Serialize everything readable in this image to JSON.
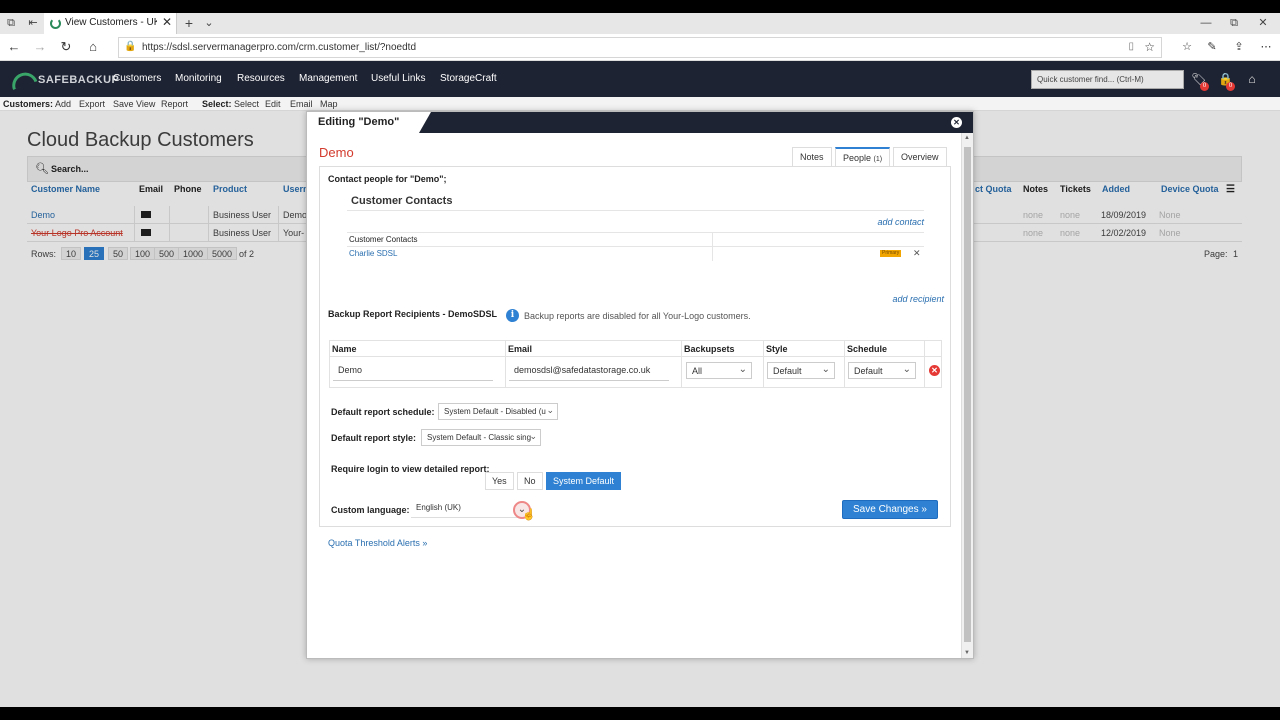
{
  "browser": {
    "tab_title": "View Customers - UK Cl",
    "url": "https://sdsl.servermanagerpro.com/crm.customer_list/?noedtd"
  },
  "appnav": {
    "brand": "SAFEBACKUP",
    "items": [
      "Customers",
      "Monitoring",
      "Resources",
      "Management",
      "Useful Links",
      "StorageCraft"
    ],
    "quick_find_placeholder": "Quick customer find... (Ctrl-M)",
    "badge_tickets": "0",
    "badge_alerts": "0"
  },
  "subbar": {
    "customers_label": "Customers:",
    "customers_actions": [
      "Add",
      "Export",
      "Save View",
      "Report"
    ],
    "select_label": "Select:",
    "select_actions": [
      "Select",
      "Edit",
      "Email",
      "Map"
    ]
  },
  "page": {
    "title": "Cloud Backup Customers",
    "search_label": "Search...",
    "columns_left": [
      "Customer Name",
      "Email",
      "Phone",
      "Product",
      "Usern"
    ],
    "columns_right": [
      "ct Quota",
      "Notes",
      "Tickets",
      "Added",
      "Device Quota"
    ],
    "rows": [
      {
        "name": "Demo",
        "product": "Business User",
        "user": "Demo",
        "notes": "none",
        "tickets": "none",
        "added": "18/09/2019",
        "device_quota": "None"
      },
      {
        "name": "Your Logo Pro Account",
        "product": "Business User",
        "user": "Your-",
        "notes": "none",
        "tickets": "none",
        "added": "12/02/2019",
        "device_quota": "None"
      }
    ],
    "rows_label": "Rows:",
    "row_options": [
      "10",
      "25",
      "50",
      "100",
      "500",
      "1000",
      "5000"
    ],
    "of_pages": "of 2",
    "page_label": "Page:",
    "page_num": "1"
  },
  "modal": {
    "header": "Editing \"Demo\"",
    "customer_name": "Demo",
    "tabs": {
      "notes": "Notes",
      "people": "People",
      "people_count": "(1)",
      "overview": "Overview"
    },
    "contact_label": "Contact people for \"Demo\";",
    "contacts_title": "Customer Contacts",
    "add_contact": "add contact",
    "contacts_header": "Customer Contacts",
    "contact_name": "Charlie SDSL",
    "primary_badge": "Primary",
    "add_recipient": "add recipient",
    "recipients_label": "Backup Report Recipients - DemoSDSL",
    "info_icon": "i",
    "info_text": "Backup reports are disabled for all Your-Logo customers.",
    "recipient_cols": [
      "Name",
      "Email",
      "Backupsets",
      "Style",
      "Schedule"
    ],
    "recipient": {
      "name": "Demo",
      "email": "demosdsl@safedatastorage.co.uk",
      "backupsets": "All",
      "style": "Default",
      "schedule": "Default"
    },
    "schedule_label": "Default report schedule:",
    "schedule_value": "System Default - Disabled (u",
    "style_label": "Default report style:",
    "style_value": "System Default - Classic sing",
    "login_label": "Require login to view detailed report:",
    "login_options": [
      "Yes",
      "No",
      "System Default"
    ],
    "language_label": "Custom language:",
    "language_value": "English (UK)",
    "save_button": "Save Changes »",
    "quota_link": "Quota Threshold Alerts »"
  }
}
